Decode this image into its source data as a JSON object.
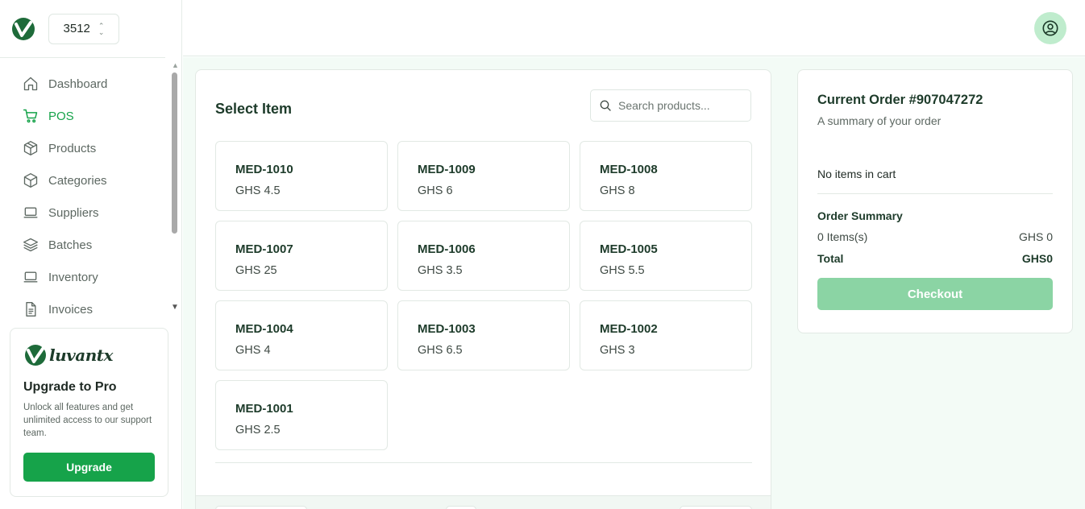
{
  "app": {
    "store_id": "3512"
  },
  "sidebar": {
    "items": [
      {
        "label": "Dashboard",
        "icon": "home-icon",
        "active": false
      },
      {
        "label": "POS",
        "icon": "cart-icon",
        "active": true
      },
      {
        "label": "Products",
        "icon": "box-icon",
        "active": false
      },
      {
        "label": "Categories",
        "icon": "box-icon",
        "active": false
      },
      {
        "label": "Suppliers",
        "icon": "laptop-icon",
        "active": false
      },
      {
        "label": "Batches",
        "icon": "layers-icon",
        "active": false
      },
      {
        "label": "Inventory",
        "icon": "laptop-icon",
        "active": false
      },
      {
        "label": "Invoices",
        "icon": "document-icon",
        "active": false
      }
    ],
    "promo": {
      "brand": "luvantx",
      "title": "Upgrade to Pro",
      "text": "Unlock all features and get unlimited access to our support team.",
      "button": "Upgrade"
    }
  },
  "main": {
    "title": "Select Item",
    "search_placeholder": "Search products...",
    "currency": "GHS",
    "products": [
      {
        "sku": "MED-1010",
        "price": "GHS 4.5"
      },
      {
        "sku": "MED-1009",
        "price": "GHS 6"
      },
      {
        "sku": "MED-1008",
        "price": "GHS 8"
      },
      {
        "sku": "MED-1007",
        "price": "GHS 25"
      },
      {
        "sku": "MED-1006",
        "price": "GHS 3.5"
      },
      {
        "sku": "MED-1005",
        "price": "GHS 5.5"
      },
      {
        "sku": "MED-1004",
        "price": "GHS 4"
      },
      {
        "sku": "MED-1003",
        "price": "GHS 6.5"
      },
      {
        "sku": "MED-1002",
        "price": "GHS 3"
      },
      {
        "sku": "MED-1001",
        "price": "GHS 2.5"
      }
    ]
  },
  "order": {
    "title": "Current Order #907047272",
    "subtitle": "A summary of your order",
    "empty_text": "No items in cart",
    "summary_title": "Order Summary",
    "items_label": "0 Items(s)",
    "items_value": "GHS 0",
    "total_label": "Total",
    "total_value": "GHS0",
    "checkout_label": "Checkout"
  },
  "colors": {
    "accent": "#16a34a",
    "checkout_disabled": "#8bd4a4",
    "avatar_bg": "#bfeccd",
    "main_bg": "#f3fbf6"
  }
}
